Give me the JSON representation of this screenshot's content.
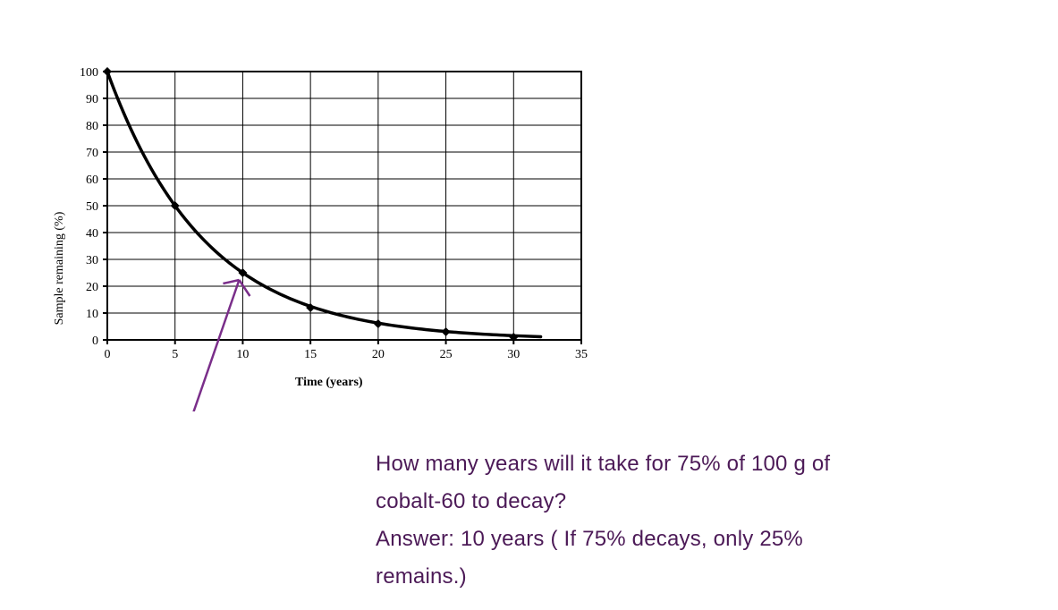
{
  "chart_data": {
    "type": "line",
    "title": "",
    "xlabel": "Time (years)",
    "ylabel": "Sample remaining (%)",
    "xlim": [
      0,
      35
    ],
    "ylim": [
      0,
      100
    ],
    "x_ticks": [
      0,
      5,
      10,
      15,
      20,
      25,
      30,
      35
    ],
    "y_ticks": [
      0,
      10,
      20,
      30,
      40,
      50,
      60,
      70,
      80,
      90,
      100
    ],
    "x": [
      0,
      5,
      10,
      15,
      20,
      25,
      30
    ],
    "y": [
      100,
      50,
      25,
      12,
      6,
      3,
      1
    ],
    "annotation": {
      "type": "arrow",
      "target_x": 10,
      "target_y": 25,
      "color": "#7a2e8a"
    }
  },
  "question": {
    "line1": "How many years will it take for 75% of 100 g of",
    "line2": "cobalt-60 to decay?",
    "line3": "Answer: 10 years ( If 75% decays, only 25%",
    "line4": "remains.)"
  }
}
